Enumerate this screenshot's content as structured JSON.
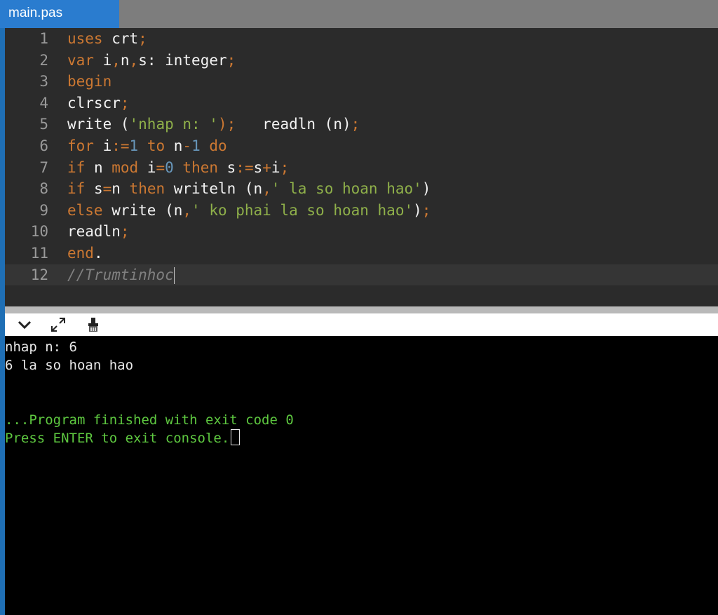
{
  "tab": {
    "label": "main.pas"
  },
  "editor": {
    "line_numbers": [
      "1",
      "2",
      "3",
      "4",
      "5",
      "6",
      "7",
      "8",
      "9",
      "10",
      "11",
      "12"
    ],
    "lines": [
      [
        {
          "t": "uses",
          "c": "kw"
        },
        {
          "t": " crt",
          "c": ""
        },
        {
          "t": ";",
          "c": "op"
        }
      ],
      [
        {
          "t": "var",
          "c": "kw"
        },
        {
          "t": " i",
          "c": ""
        },
        {
          "t": ",",
          "c": "op"
        },
        {
          "t": "n",
          "c": ""
        },
        {
          "t": ",",
          "c": "op"
        },
        {
          "t": "s: integer",
          "c": ""
        },
        {
          "t": ";",
          "c": "op"
        }
      ],
      [
        {
          "t": "begin",
          "c": "kw"
        }
      ],
      [
        {
          "t": "clrscr",
          "c": ""
        },
        {
          "t": ";",
          "c": "op"
        }
      ],
      [
        {
          "t": "write (",
          "c": ""
        },
        {
          "t": "'nhap n: '",
          "c": "str"
        },
        {
          "t": ");",
          "c": "op"
        },
        {
          "t": "   readln (n)",
          "c": ""
        },
        {
          "t": ";",
          "c": "op"
        }
      ],
      [
        {
          "t": "for",
          "c": "kw"
        },
        {
          "t": " i",
          "c": ""
        },
        {
          "t": ":=",
          "c": "op"
        },
        {
          "t": "1",
          "c": "num"
        },
        {
          "t": " to ",
          "c": "kw"
        },
        {
          "t": "n",
          "c": ""
        },
        {
          "t": "-",
          "c": "op"
        },
        {
          "t": "1",
          "c": "num"
        },
        {
          "t": " do",
          "c": "kw"
        }
      ],
      [
        {
          "t": "if",
          "c": "kw"
        },
        {
          "t": " n ",
          "c": ""
        },
        {
          "t": "mod",
          "c": "kw"
        },
        {
          "t": " i",
          "c": ""
        },
        {
          "t": "=",
          "c": "op"
        },
        {
          "t": "0",
          "c": "num"
        },
        {
          "t": " then",
          "c": "kw"
        },
        {
          "t": " s",
          "c": ""
        },
        {
          "t": ":=",
          "c": "op"
        },
        {
          "t": "s",
          "c": ""
        },
        {
          "t": "+",
          "c": "op"
        },
        {
          "t": "i",
          "c": ""
        },
        {
          "t": ";",
          "c": "op"
        }
      ],
      [
        {
          "t": "if",
          "c": "kw"
        },
        {
          "t": " s",
          "c": ""
        },
        {
          "t": "=",
          "c": "op"
        },
        {
          "t": "n ",
          "c": ""
        },
        {
          "t": "then",
          "c": "kw"
        },
        {
          "t": " writeln (n",
          "c": ""
        },
        {
          "t": ",",
          "c": "op"
        },
        {
          "t": "' la so hoan hao'",
          "c": "str"
        },
        {
          "t": ")",
          "c": ""
        }
      ],
      [
        {
          "t": "else",
          "c": "kw"
        },
        {
          "t": " write (n",
          "c": ""
        },
        {
          "t": ",",
          "c": "op"
        },
        {
          "t": "' ko phai la so hoan hao'",
          "c": "str"
        },
        {
          "t": ")",
          "c": ""
        },
        {
          "t": ";",
          "c": "op"
        }
      ],
      [
        {
          "t": "readln",
          "c": ""
        },
        {
          "t": ";",
          "c": "op"
        }
      ],
      [
        {
          "t": "end",
          "c": "kw"
        },
        {
          "t": ".",
          "c": ""
        }
      ],
      [
        {
          "t": "//Trumtinhoc",
          "c": "cm"
        }
      ]
    ]
  },
  "console_toolbar": {
    "collapse_icon": "chevron-down-icon",
    "expand_icon": "expand-icon",
    "clear_icon": "clear-console-icon"
  },
  "console": {
    "lines": [
      {
        "text": "nhap n: 6",
        "color": "white"
      },
      {
        "text": "6 la so hoan hao",
        "color": "white"
      },
      {
        "text": "",
        "color": "white"
      },
      {
        "text": "",
        "color": "white"
      },
      {
        "text": "...Program finished with exit code 0",
        "color": "green"
      },
      {
        "text": "Press ENTER to exit console.",
        "color": "green"
      }
    ]
  },
  "colors": {
    "keyword": "#cc7832",
    "string": "#8fb04a",
    "number": "#6897bb",
    "comment": "#808080",
    "console_green": "#5ec840"
  }
}
